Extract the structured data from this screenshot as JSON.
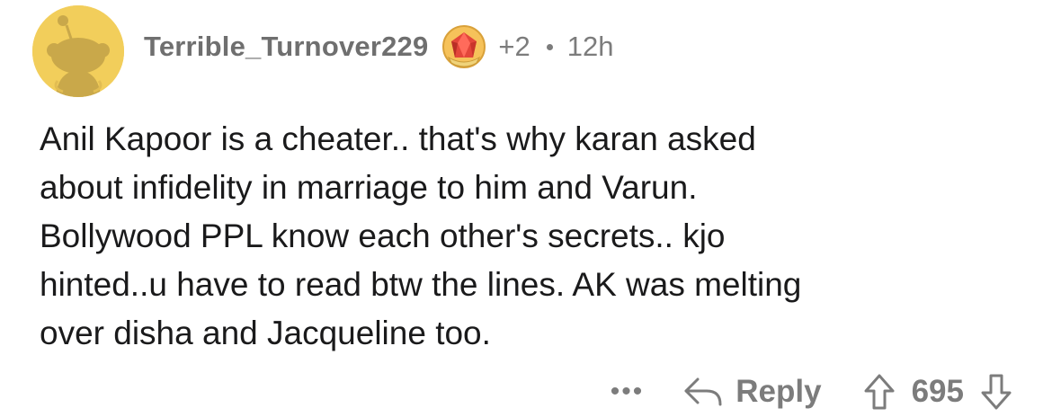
{
  "comment": {
    "username": "Terrible_Turnover229",
    "award_icon": "ruby-award-icon",
    "award_count": "+2",
    "separator": "•",
    "time": "12h",
    "body_lines": [
      "Anil Kapoor is a cheater.. that's why karan asked",
      "about infidelity in marriage to him and Varun.",
      "Bollywood PPL know each other's secrets.. kjo",
      "hinted..u have to read btw the lines. AK was melting",
      "over disha and Jacqueline too."
    ]
  },
  "actions": {
    "more_label": "•••",
    "reply_label": "Reply",
    "score": "695",
    "icons": [
      "reply-arrow-icon",
      "upvote-icon",
      "downvote-icon"
    ]
  },
  "colors": {
    "avatar_bg": "#f2ce5b",
    "meta_text": "#7c7c7c",
    "body_text": "#1a1a1b"
  }
}
